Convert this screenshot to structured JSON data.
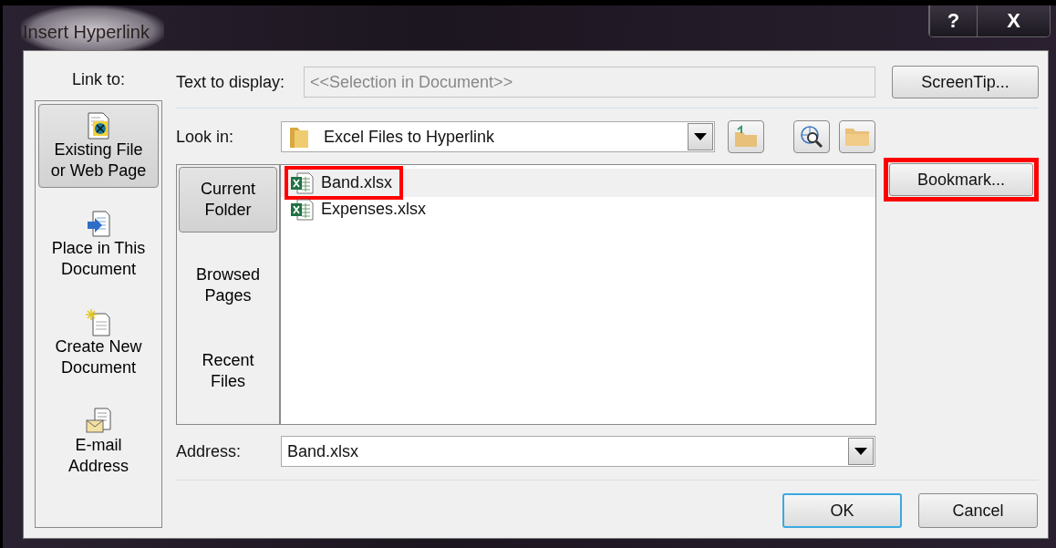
{
  "window": {
    "title": "Insert Hyperlink",
    "controls": [
      {
        "kind": "help",
        "label": "?"
      },
      {
        "kind": "close",
        "label": "X"
      }
    ]
  },
  "link_to": {
    "label": "Link to:",
    "items": [
      {
        "kind": "file",
        "lines": [
          "Existing File",
          "or Web Page"
        ],
        "selected": true
      },
      {
        "kind": "place",
        "lines": [
          "Place in This",
          "Document"
        ],
        "selected": false
      },
      {
        "kind": "new",
        "lines": [
          "Create New",
          "Document"
        ],
        "selected": false
      },
      {
        "kind": "email",
        "lines": [
          "E-mail",
          "Address"
        ],
        "selected": false
      }
    ]
  },
  "text_to_display": {
    "label": "Text to display:",
    "value": "<<Selection in Document>>",
    "disabled": true
  },
  "screentip_button": "ScreenTip...",
  "look_in": {
    "label": "Look in:",
    "value": "Excel Files to Hyperlink"
  },
  "browse_tabs": [
    {
      "lines": [
        "Current",
        "Folder"
      ],
      "selected": true
    },
    {
      "lines": [
        "Browsed",
        "Pages"
      ],
      "selected": false
    },
    {
      "lines": [
        "Recent",
        "Files"
      ],
      "selected": false
    }
  ],
  "files": [
    {
      "name": "Band.xlsx",
      "selected": true,
      "highlighted": true
    },
    {
      "name": "Expenses.xlsx",
      "selected": false,
      "highlighted": false
    }
  ],
  "bookmark_button": {
    "label": "Bookmark...",
    "highlighted": true
  },
  "address": {
    "label": "Address:",
    "value": "Band.xlsx"
  },
  "buttons": [
    {
      "label": "OK",
      "default": true
    },
    {
      "label": "Cancel",
      "default": false
    }
  ]
}
